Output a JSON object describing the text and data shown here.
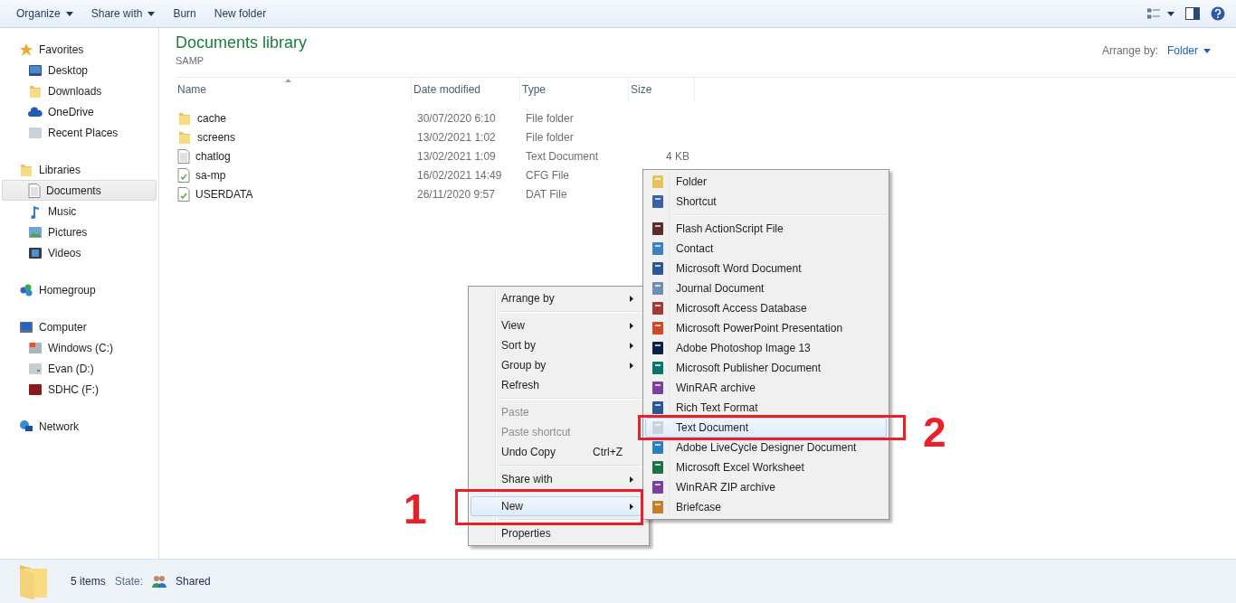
{
  "toolbar": {
    "buttons": [
      {
        "label": "Organize",
        "dropdown": true
      },
      {
        "label": "Share with",
        "dropdown": true
      },
      {
        "label": "Burn",
        "dropdown": false
      },
      {
        "label": "New folder",
        "dropdown": false
      }
    ]
  },
  "sidebar": {
    "groups": [
      {
        "label": "Favorites",
        "selected": false,
        "children": [
          {
            "label": "Desktop",
            "selected": false
          },
          {
            "label": "Downloads",
            "selected": false
          },
          {
            "label": "OneDrive",
            "selected": false
          },
          {
            "label": "Recent Places",
            "selected": false
          }
        ]
      },
      {
        "label": "Libraries",
        "selected": false,
        "children": [
          {
            "label": "Documents",
            "selected": true
          },
          {
            "label": "Music",
            "selected": false
          },
          {
            "label": "Pictures",
            "selected": false
          },
          {
            "label": "Videos",
            "selected": false
          }
        ]
      },
      {
        "label": "Homegroup",
        "selected": false
      },
      {
        "label": "Computer",
        "selected": false,
        "children": [
          {
            "label": "Windows (C:)",
            "selected": false
          },
          {
            "label": "Evan (D:)",
            "selected": false
          },
          {
            "label": "SDHC (F:)",
            "selected": false
          }
        ]
      },
      {
        "label": "Network",
        "selected": false
      }
    ]
  },
  "library": {
    "title": "Documents library",
    "subtitle": "SAMP",
    "arrange_label": "Arrange by:",
    "arrange_value": "Folder"
  },
  "table": {
    "columns": [
      "Name",
      "Date modified",
      "Type",
      "Size"
    ],
    "rows": [
      {
        "name": "cache",
        "date": "30/07/2020 6:10",
        "type": "File folder"
      },
      {
        "name": "screens",
        "date": "13/02/2021 1:02",
        "type": "File folder"
      },
      {
        "name": "chatlog",
        "date": "13/02/2021 1:09",
        "type": "Text Document",
        "size": "4 KB"
      },
      {
        "name": "sa-mp",
        "date": "16/02/2021 14:49",
        "type": "CFG File"
      },
      {
        "name": "USERDATA",
        "date": "26/11/2020 9:57",
        "type": "DAT File"
      }
    ]
  },
  "context_menu": {
    "items": [
      {
        "kind": "item",
        "label": "Arrange by",
        "submenu": true,
        "disabled": false,
        "selected": false
      },
      {
        "kind": "separator"
      },
      {
        "kind": "item",
        "label": "View",
        "submenu": true,
        "disabled": false,
        "selected": false
      },
      {
        "kind": "item",
        "label": "Sort by",
        "submenu": true,
        "disabled": false,
        "selected": false
      },
      {
        "kind": "item",
        "label": "Group by",
        "submenu": true,
        "disabled": false,
        "selected": false
      },
      {
        "kind": "item",
        "label": "Refresh",
        "submenu": false,
        "disabled": false,
        "selected": false
      },
      {
        "kind": "separator"
      },
      {
        "kind": "item",
        "label": "Paste",
        "submenu": false,
        "disabled": true,
        "selected": false
      },
      {
        "kind": "item",
        "label": "Paste shortcut",
        "submenu": false,
        "disabled": true,
        "selected": false
      },
      {
        "kind": "item",
        "label": "Undo Copy",
        "shortcut": "Ctrl+Z",
        "submenu": false,
        "disabled": false,
        "selected": false
      },
      {
        "kind": "separator"
      },
      {
        "kind": "item",
        "label": "Share with",
        "submenu": true,
        "disabled": false,
        "selected": false
      },
      {
        "kind": "separator"
      },
      {
        "kind": "item",
        "label": "New",
        "submenu": true,
        "disabled": false,
        "selected": true
      },
      {
        "kind": "separator"
      },
      {
        "kind": "item",
        "label": "Properties",
        "submenu": false,
        "disabled": false,
        "selected": false
      }
    ]
  },
  "new_submenu": {
    "items": [
      {
        "kind": "item",
        "label": "Folder",
        "selected": false
      },
      {
        "kind": "item",
        "label": "Shortcut",
        "selected": false
      },
      {
        "kind": "separator"
      },
      {
        "kind": "item",
        "label": "Flash ActionScript File",
        "selected": false
      },
      {
        "kind": "item",
        "label": "Contact",
        "selected": false
      },
      {
        "kind": "item",
        "label": "Microsoft Word Document",
        "selected": false
      },
      {
        "kind": "item",
        "label": "Journal Document",
        "selected": false
      },
      {
        "kind": "item",
        "label": "Microsoft Access Database",
        "selected": false
      },
      {
        "kind": "item",
        "label": "Microsoft PowerPoint Presentation",
        "selected": false
      },
      {
        "kind": "item",
        "label": "Adobe Photoshop Image 13",
        "selected": false
      },
      {
        "kind": "item",
        "label": "Microsoft Publisher Document",
        "selected": false
      },
      {
        "kind": "item",
        "label": "WinRAR archive",
        "selected": false
      },
      {
        "kind": "item",
        "label": "Rich Text Format",
        "selected": false
      },
      {
        "kind": "item",
        "label": "Text Document",
        "selected": true
      },
      {
        "kind": "item",
        "label": "Adobe LiveCycle Designer Document",
        "selected": false
      },
      {
        "kind": "item",
        "label": "Microsoft Excel Worksheet",
        "selected": false
      },
      {
        "kind": "item",
        "label": "WinRAR ZIP archive",
        "selected": false
      },
      {
        "kind": "item",
        "label": "Briefcase",
        "selected": false
      }
    ]
  },
  "annotations": [
    {
      "label": "1"
    },
    {
      "label": "2"
    }
  ],
  "status_bar": {
    "count": "5 items",
    "state_label": "State:",
    "state_value": "Shared"
  }
}
